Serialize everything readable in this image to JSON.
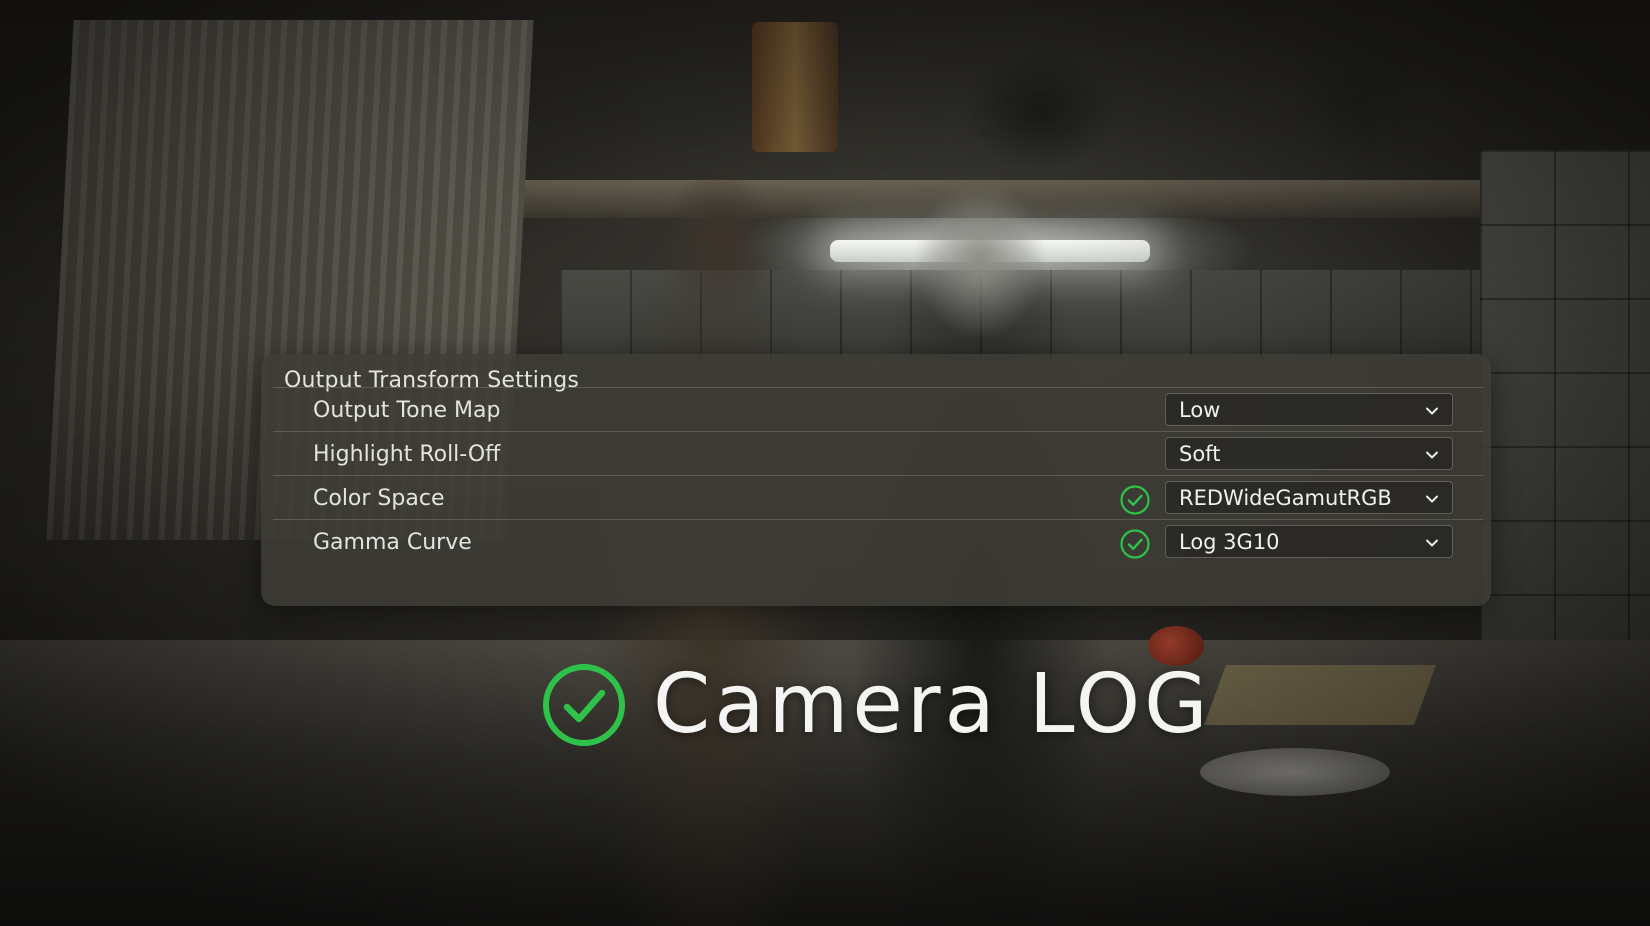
{
  "panel": {
    "title": "Output Transform Settings",
    "rows": [
      {
        "label": "Output Tone Map",
        "value": "Low",
        "status": null
      },
      {
        "label": "Highlight Roll-Off",
        "value": "Soft",
        "status": null
      },
      {
        "label": "Color Space",
        "value": "REDWideGamutRGB",
        "status": "check-circle-icon"
      },
      {
        "label": "Gamma Curve",
        "value": "Log 3G10",
        "status": "check-circle-icon"
      }
    ]
  },
  "caption": {
    "text": "Camera LOG",
    "icon": "check-circle-icon"
  },
  "colors": {
    "check_green": "#2fc24a",
    "panel_bg": "#3e3c36",
    "text": "#e3e3df"
  }
}
